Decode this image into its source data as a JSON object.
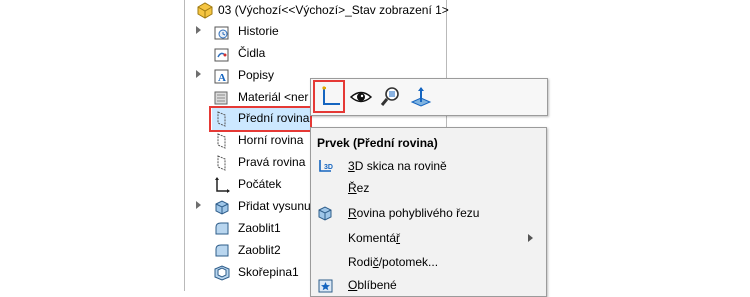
{
  "tree": {
    "root_label": "03  (Výchozí<<Výchozí>_Stav zobrazení 1>",
    "items": [
      {
        "label": "Historie"
      },
      {
        "label": "Čidla"
      },
      {
        "label": "Popisy"
      },
      {
        "label": "Materiál <ner"
      },
      {
        "label": "Přední rovina"
      },
      {
        "label": "Horní rovina"
      },
      {
        "label": "Pravá rovina"
      },
      {
        "label": "Počátek"
      },
      {
        "label": "Přidat vysunu"
      },
      {
        "label": "Zaoblit1"
      },
      {
        "label": "Zaoblit2"
      },
      {
        "label": "Skořepina1"
      }
    ]
  },
  "context_toolbar": {
    "buttons": [
      {
        "icon": "sketch-icon"
      },
      {
        "icon": "eye-icon"
      },
      {
        "icon": "zoom-to-selection-icon"
      },
      {
        "icon": "normal-to-icon"
      }
    ]
  },
  "context_menu": {
    "title": "Prvek (Přední rovina)",
    "items": [
      {
        "prefix": "",
        "hotkey": "3",
        "rest": "D skica na rovině",
        "icon": "3d-sketch-icon"
      },
      {
        "prefix": "",
        "hotkey": "Ř",
        "rest": "ez",
        "icon": ""
      },
      {
        "prefix": "",
        "hotkey": "R",
        "rest": "ovina pohyblivého řezu",
        "icon": "moving-section-plane-icon"
      },
      {
        "prefix": "Komentá",
        "hotkey": "ř",
        "rest": "",
        "icon": "",
        "submenu": true
      },
      {
        "prefix": "Rodi",
        "hotkey": "č",
        "rest": "/potomek...",
        "icon": ""
      },
      {
        "prefix": "",
        "hotkey": "O",
        "rest": "blíbené",
        "icon": "favorites-icon"
      }
    ]
  },
  "colors": {
    "selection": "#cce8ff",
    "highlight_box": "#e53935",
    "icon_blue": "#1565c0",
    "folder_yellow": "#f5c542"
  }
}
